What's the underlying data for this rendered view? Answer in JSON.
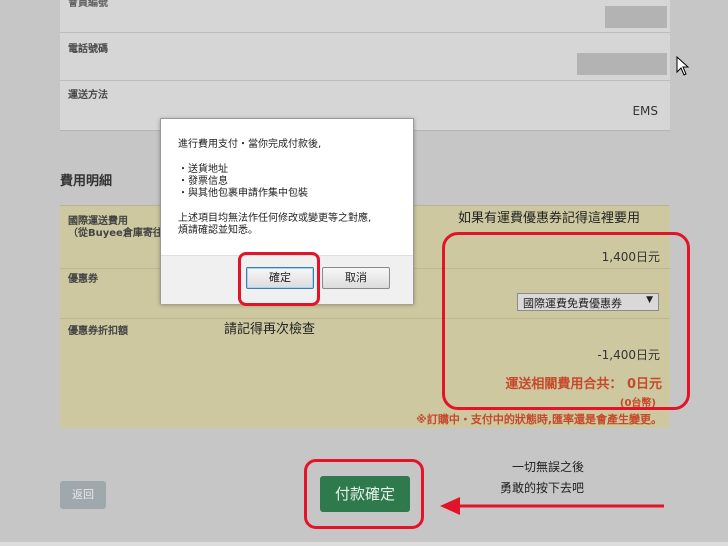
{
  "form": {
    "top_label": "會員編號",
    "phone_label": "電話號碼",
    "shipping_label": "運送方法",
    "shipping_value": "EMS"
  },
  "fees": {
    "section_title": "費用明細",
    "intl_label_line1": "國際運送費用",
    "intl_label_line2": "（從Buyee倉庫寄往",
    "intl_amount": "1,400日元",
    "coupon_label": "優惠券",
    "coupon_select": "國際運費免費優惠券",
    "discount_label": "優惠券折扣額",
    "discount_amount": "-1,400日元",
    "total": "運送相關費用合共： 0日元",
    "total_sub": "(0台幣)",
    "warning": "※訂購中・支付中的狀態時,匯率還是會產生變更。"
  },
  "buttons": {
    "back": "返回",
    "pay": "付款確定"
  },
  "dialog": {
    "line1": "進行費用支付・當你完成付款後,",
    "item1": "・送貨地址",
    "item2": "・發票信息",
    "item3": "・與其他包裹申請作集中包裝",
    "note1": "上述項目均無法作任何修改或變更等之對應,",
    "note2": "煩請確認並知悉。",
    "ok": "確定",
    "cancel": "取消"
  },
  "annotations": {
    "coupon_note": "如果有運費優惠券記得這裡要用",
    "check_note": "請記得再次檢查",
    "final_line1": "一切無誤之後",
    "final_line2": "勇敢的按下去吧"
  },
  "colors": {
    "highlight_red": "#e3142a",
    "pay_green": "#2f7a4d",
    "total_orange": "#c54a2b"
  },
  "icons": {
    "cursor": "mouse-cursor-icon",
    "arrow": "red-arrow-left-icon",
    "dropdown": "chevron-down-icon"
  }
}
